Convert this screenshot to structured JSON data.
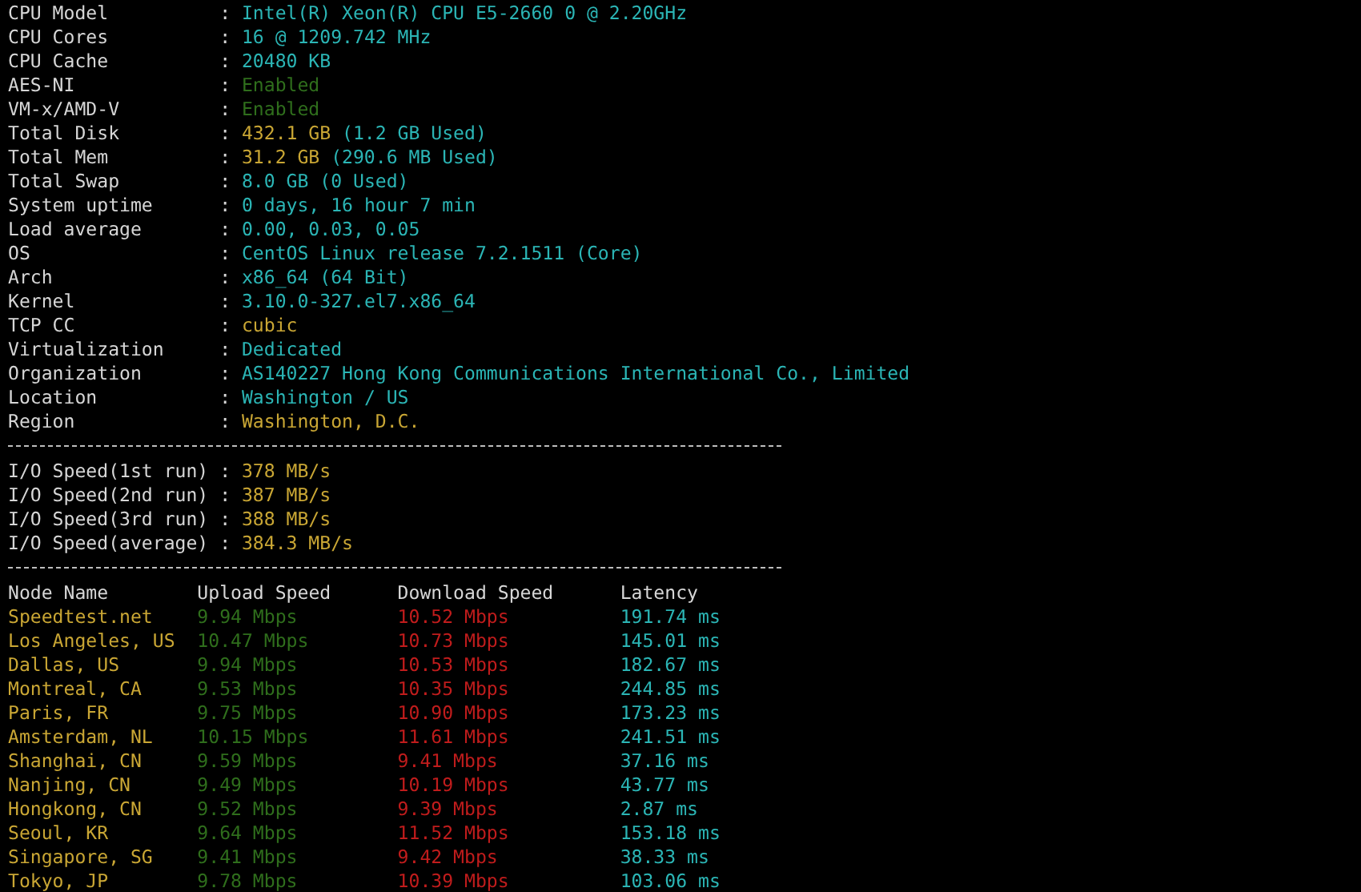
{
  "system_info": [
    {
      "label": "CPU Model",
      "sep": ":",
      "value": [
        {
          "text": "Intel(R) Xeon(R) CPU E5-2660 0 @ 2.20GHz",
          "color": "#2bb5b5"
        }
      ]
    },
    {
      "label": "CPU Cores",
      "sep": ":",
      "value": [
        {
          "text": "16 @ 1209.742 MHz",
          "color": "#2bb5b5"
        }
      ]
    },
    {
      "label": "CPU Cache",
      "sep": ":",
      "value": [
        {
          "text": "20480 KB",
          "color": "#2bb5b5"
        }
      ]
    },
    {
      "label": "AES-NI",
      "sep": ":",
      "value": [
        {
          "text": "Enabled",
          "color": "#2f6e1c"
        }
      ]
    },
    {
      "label": "VM-x/AMD-V",
      "sep": ":",
      "value": [
        {
          "text": "Enabled",
          "color": "#2f6e1c"
        }
      ]
    },
    {
      "label": "Total Disk",
      "sep": ":",
      "value": [
        {
          "text": "432.1 GB",
          "color": "#c9a634"
        },
        {
          "text": "(1.2 GB Used)",
          "color": "#2bb5b5"
        }
      ]
    },
    {
      "label": "Total Mem",
      "sep": ":",
      "value": [
        {
          "text": "31.2 GB",
          "color": "#c9a634"
        },
        {
          "text": "(290.6 MB Used)",
          "color": "#2bb5b5"
        }
      ]
    },
    {
      "label": "Total Swap",
      "sep": ":",
      "value": [
        {
          "text": "8.0 GB (0 Used)",
          "color": "#2bb5b5"
        }
      ]
    },
    {
      "label": "System uptime",
      "sep": ":",
      "value": [
        {
          "text": "0 days, 16 hour 7 min",
          "color": "#2bb5b5"
        }
      ]
    },
    {
      "label": "Load average",
      "sep": ":",
      "value": [
        {
          "text": "0.00, 0.03, 0.05",
          "color": "#2bb5b5"
        }
      ]
    },
    {
      "label": "OS",
      "sep": ":",
      "value": [
        {
          "text": "CentOS Linux release 7.2.1511 (Core)",
          "color": "#2bb5b5"
        }
      ]
    },
    {
      "label": "Arch",
      "sep": ":",
      "value": [
        {
          "text": "x86_64 (64 Bit)",
          "color": "#2bb5b5"
        }
      ]
    },
    {
      "label": "Kernel",
      "sep": ":",
      "value": [
        {
          "text": "3.10.0-327.el7.x86_64",
          "color": "#2bb5b5"
        }
      ]
    },
    {
      "label": "TCP CC",
      "sep": ":",
      "value": [
        {
          "text": "cubic",
          "color": "#c9a634"
        }
      ]
    },
    {
      "label": "Virtualization",
      "sep": ":",
      "value": [
        {
          "text": "Dedicated",
          "color": "#2bb5b5"
        }
      ]
    },
    {
      "label": "Organization",
      "sep": ":",
      "value": [
        {
          "text": "AS140227 Hong Kong Communications International Co., Limited",
          "color": "#2bb5b5"
        }
      ]
    },
    {
      "label": "Location",
      "sep": ":",
      "value": [
        {
          "text": "Washington / US",
          "color": "#2bb5b5"
        }
      ]
    },
    {
      "label": "Region",
      "sep": ":",
      "value": [
        {
          "text": "Washington, D.C.",
          "color": "#c9a634"
        }
      ]
    }
  ],
  "io_speed": [
    {
      "label": "I/O Speed(1st run)",
      "sep": ":",
      "value": "378 MB/s"
    },
    {
      "label": "I/O Speed(2nd run)",
      "sep": ":",
      "value": "387 MB/s"
    },
    {
      "label": "I/O Speed(3rd run)",
      "sep": ":",
      "value": "388 MB/s"
    },
    {
      "label": "I/O Speed(average)",
      "sep": ":",
      "value": "384.3 MB/s"
    }
  ],
  "speed_table": {
    "columns": [
      "Node Name",
      "Upload Speed",
      "Download Speed",
      "Latency"
    ],
    "rows": [
      [
        "Speedtest.net",
        "9.94 Mbps",
        "10.52 Mbps",
        "191.74 ms"
      ],
      [
        "Los Angeles, US",
        "10.47 Mbps",
        "10.73 Mbps",
        "145.01 ms"
      ],
      [
        "Dallas, US",
        "9.94 Mbps",
        "10.53 Mbps",
        "182.67 ms"
      ],
      [
        "Montreal, CA",
        "9.53 Mbps",
        "10.35 Mbps",
        "244.85 ms"
      ],
      [
        "Paris, FR",
        "9.75 Mbps",
        "10.90 Mbps",
        "173.23 ms"
      ],
      [
        "Amsterdam, NL",
        "10.15 Mbps",
        "11.61 Mbps",
        "241.51 ms"
      ],
      [
        "Shanghai, CN",
        "9.59 Mbps",
        "9.41 Mbps",
        "37.16 ms"
      ],
      [
        "Nanjing, CN",
        "9.49 Mbps",
        "10.19 Mbps",
        "43.77 ms"
      ],
      [
        "Hongkong, CN",
        "9.52 Mbps",
        "9.39 Mbps",
        "2.87 ms"
      ],
      [
        "Seoul, KR",
        "9.64 Mbps",
        "11.52 Mbps",
        "153.18 ms"
      ],
      [
        "Singapore, SG",
        "9.41 Mbps",
        "9.42 Mbps",
        "38.33 ms"
      ],
      [
        "Tokyo, JP",
        "9.78 Mbps",
        "10.39 Mbps",
        "103.06 ms"
      ]
    ]
  }
}
